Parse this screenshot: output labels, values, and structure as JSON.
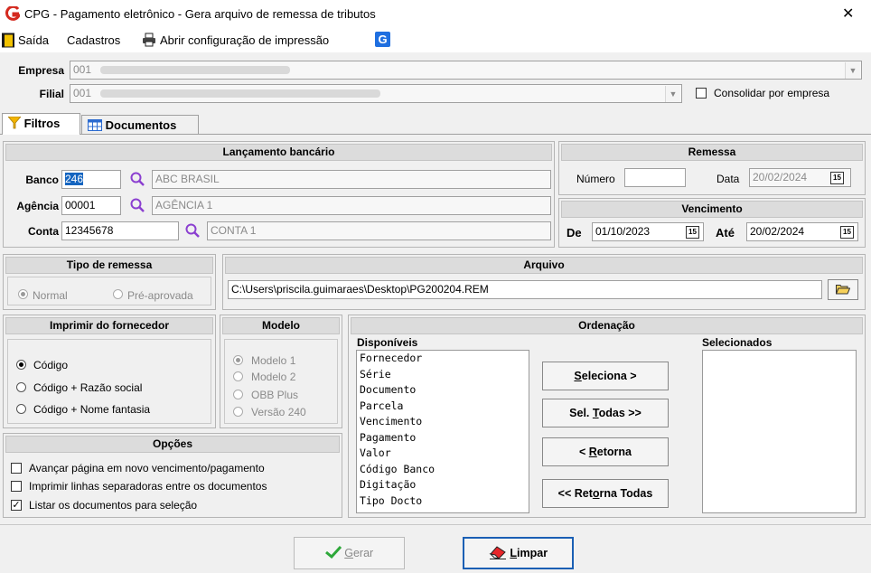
{
  "window": {
    "title": "CPG -  Pagamento eletrônico - Gera arquivo de remessa de tributos",
    "close_glyph": "✕"
  },
  "menu": {
    "saida": "Saída",
    "cadastros": "Cadastros",
    "abrir_config": "Abrir configuração de impressão"
  },
  "empresa": {
    "label": "Empresa",
    "value": "001"
  },
  "filial": {
    "label": "Filial",
    "value": "001",
    "consolidar_label": "Consolidar por empresa",
    "consolidar_checked": false
  },
  "tabs": [
    {
      "label": "Filtros",
      "icon": "filter-icon"
    },
    {
      "label": "Documentos",
      "icon": "grid-icon"
    }
  ],
  "lancamento": {
    "title": "Lançamento bancário",
    "banco_label": "Banco",
    "banco_value": "246",
    "banco_name": "ABC BRASIL",
    "agencia_label": "Agência",
    "agencia_value": "00001",
    "agencia_name": "AGÊNCIA 1",
    "conta_label": "Conta",
    "conta_value": "12345678",
    "conta_name": "CONTA 1"
  },
  "remessa": {
    "title": "Remessa",
    "numero_label": "Número",
    "numero_value": "",
    "data_label": "Data",
    "data_value": "20/02/2024"
  },
  "vencimento": {
    "title": "Vencimento",
    "de_label": "De",
    "de_value": "01/10/2023",
    "ate_label": "Até",
    "ate_value": "20/02/2024"
  },
  "calendar_glyph": "15",
  "tipo_remessa": {
    "title": "Tipo de remessa",
    "options": [
      "Normal",
      "Pré-aprovada"
    ],
    "selected": 0
  },
  "arquivo": {
    "title": "Arquivo",
    "value": "C:\\Users\\priscila.guimaraes\\Desktop\\PG200204.REM"
  },
  "imprimir": {
    "title": "Imprimir do fornecedor",
    "options": [
      "Código",
      "Código + Razão social",
      "Código + Nome fantasia"
    ],
    "selected": 0
  },
  "modelo": {
    "title": "Modelo",
    "options": [
      "Modelo 1",
      "Modelo 2",
      "OBB Plus",
      "Versão 240"
    ],
    "selected": 0
  },
  "opcoes": {
    "title": "Opções",
    "items": [
      {
        "label": "Avançar página em novo vencimento/pagamento",
        "checked": false
      },
      {
        "label": "Imprimir linhas separadoras entre os documentos",
        "checked": false
      },
      {
        "label": "Listar os documentos para seleção",
        "checked": true
      }
    ]
  },
  "ordenacao": {
    "title": "Ordenação",
    "disponiveis_label": "Disponíveis",
    "selecionados_label": "Selecionados",
    "disponiveis": [
      "Fornecedor",
      "Série",
      "Documento",
      "Parcela",
      "Vencimento",
      "Pagamento",
      "Valor",
      "Código Banco",
      "Digitação",
      "Tipo Docto"
    ],
    "selecionados": [],
    "buttons": {
      "seleciona": {
        "pre": "",
        "u": "S",
        "post": "eleciona >"
      },
      "sel_todas": {
        "pre": "Sel. ",
        "u": "T",
        "post": "odas >>"
      },
      "retorna": {
        "pre": "< ",
        "u": "R",
        "post": "etorna"
      },
      "retorna_todas": {
        "pre": "<< Ret",
        "u": "o",
        "post": "rna Todas"
      }
    }
  },
  "footer": {
    "gerar": {
      "pre": "",
      "u": "G",
      "post": "erar",
      "enabled": false
    },
    "limpar": {
      "pre": "",
      "u": "L",
      "post": "impar"
    }
  },
  "colors": {
    "accent": "#1a5fb4",
    "logo_red": "#d42a1f",
    "search_purple": "#8b3fd0",
    "check_green": "#2ea83a"
  }
}
